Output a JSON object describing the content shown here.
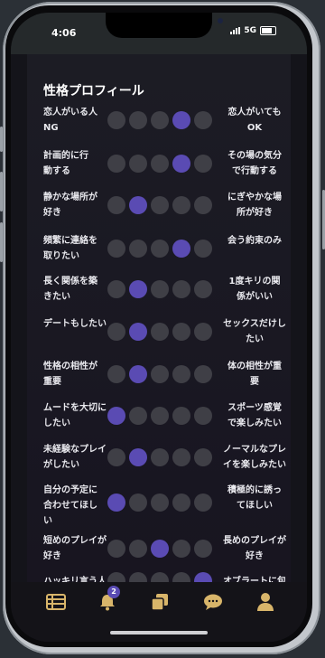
{
  "status_bar": {
    "time": "4:06",
    "network": "5G"
  },
  "profile": {
    "title": "性格プロフィール",
    "rows": [
      {
        "left": [
          "恋人がいる人",
          "NG"
        ],
        "right": [
          "恋人がいても",
          "OK"
        ],
        "selected": 4
      },
      {
        "left": [
          "計画的に行",
          "動する"
        ],
        "right": [
          "その場の気分",
          "で行動する"
        ],
        "selected": 4
      },
      {
        "left": [
          "静かな場所が",
          "好き"
        ],
        "right": [
          "にぎやかな場",
          "所が好き"
        ],
        "selected": 2
      },
      {
        "left": [
          "頻繁に連絡を",
          "取りたい"
        ],
        "right": [
          "会う約束のみ"
        ],
        "selected": 4
      },
      {
        "left": [
          "長く関係を築",
          "きたい"
        ],
        "right": [
          "1度キリの関",
          "係がいい"
        ],
        "selected": 2
      },
      {
        "left": [
          "デートもしたい"
        ],
        "right": [
          "セックスだけし",
          "たい"
        ],
        "selected": 2
      },
      {
        "left": [
          "性格の相性が",
          "重要"
        ],
        "right": [
          "体の相性が重",
          "要"
        ],
        "selected": 2
      },
      {
        "left": [
          "ムードを大切に",
          "したい"
        ],
        "right": [
          "スポーツ感覚",
          "で楽しみたい"
        ],
        "selected": 1
      },
      {
        "left": [
          "未経験なプレイ",
          "がしたい"
        ],
        "right": [
          "ノーマルなプレ",
          "イを楽しみたい"
        ],
        "selected": 2
      },
      {
        "left": [
          "自分の予定に",
          "合わせてほし",
          "い"
        ],
        "right": [
          "積極的に誘っ",
          "てほしい"
        ],
        "selected": 1
      },
      {
        "left": [
          "短めのプレイが",
          "好き"
        ],
        "right": [
          "長めのプレイが",
          "好き"
        ],
        "selected": 3
      },
      {
        "left": [
          "ハッキリ言う人"
        ],
        "right": [
          "オブラートに包"
        ],
        "selected": 5
      }
    ]
  },
  "tab_bar": {
    "items": [
      {
        "icon": "list-icon"
      },
      {
        "icon": "bell-icon",
        "badge": "2"
      },
      {
        "icon": "copy-icon"
      },
      {
        "icon": "chat-icon"
      },
      {
        "icon": "person-icon"
      }
    ]
  },
  "colors": {
    "accent": "#5a4bb3",
    "dot_off": "#3f3f46",
    "tab_icon": "#d8b56a"
  }
}
